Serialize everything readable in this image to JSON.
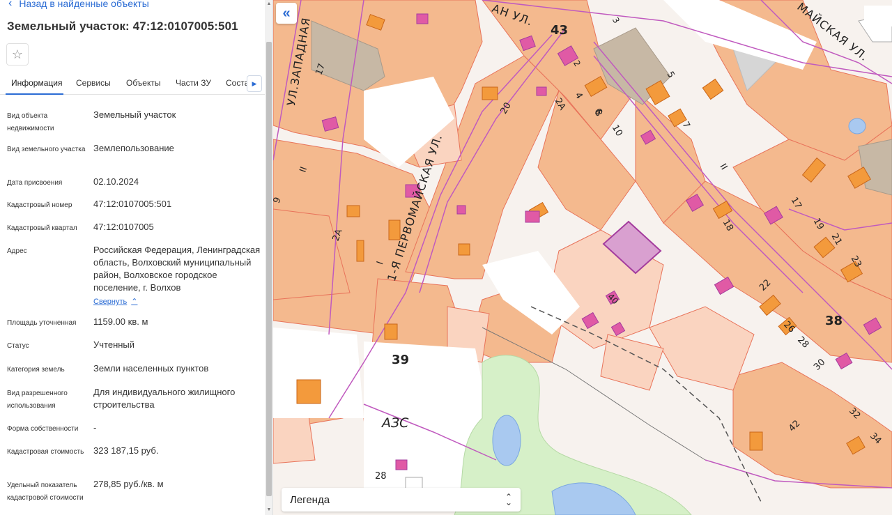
{
  "nav": {
    "back_label": "Назад в найденные объекты",
    "back_icon": "chevron-left-icon"
  },
  "title": "Земельный участок: 47:12:0107005:501",
  "favorite_icon": "star-icon",
  "tabs": [
    {
      "label": "Информация",
      "active": true
    },
    {
      "label": "Сервисы",
      "active": false
    },
    {
      "label": "Объекты",
      "active": false
    },
    {
      "label": "Части ЗУ",
      "active": false
    },
    {
      "label": "Состав",
      "active": false
    }
  ],
  "info": [
    {
      "label": "Вид объекта недвижимости",
      "value": "Земельный участок"
    },
    {
      "label": "Вид земельного участка",
      "value": "Землепользование"
    },
    {
      "label": "Дата присвоения",
      "value": "02.10.2024"
    },
    {
      "label": "Кадастровый номер",
      "value": "47:12:0107005:501"
    },
    {
      "label": "Кадастровый квартал",
      "value": "47:12:0107005"
    },
    {
      "label": "Адрес",
      "value": "Российская Федерация, Ленинградская область, Волховский муниципальный район, Волховское городское поселение, г. Волхов"
    },
    {
      "label": "Площадь уточненная",
      "value": "1159.00 кв. м"
    },
    {
      "label": "Статус",
      "value": "Учтенный"
    },
    {
      "label": "Категория земель",
      "value": "Земли населенных пунктов"
    },
    {
      "label": "Вид разрешенного использования",
      "value": "Для индивидуального жилищного строительства"
    },
    {
      "label": "Форма собственности",
      "value": "-"
    },
    {
      "label": "Кадастровая стоимость",
      "value": "323 187,15 руб."
    },
    {
      "label": "Удельный показатель кадастровой стоимости",
      "value": "278,85 руб./кв. м"
    }
  ],
  "collapse_label": "Свернуть",
  "map": {
    "collapse_icon": "double-chevron-left-icon",
    "legend_label": "Легенда",
    "streets": {
      "zapadnaya": "УЛ.ЗАПАДНАЯ",
      "pervomayskaya": "1-Я ПЕРВОМАЙСКАЯ УЛ.",
      "top_street": "АН УЛ.",
      "top_right_street": "МАЙСКАЯ УЛ."
    },
    "azs": "АЗС",
    "house_numbers": [
      "43",
      "3",
      "2",
      "2А",
      "4",
      "6",
      "8",
      "10",
      "20",
      "5",
      "7",
      "II",
      "17",
      "19",
      "21",
      "23",
      "18",
      "22",
      "26",
      "28",
      "30",
      "32",
      "34",
      "38",
      "39",
      "42",
      "40",
      "28",
      "17",
      "II",
      "9",
      "2А",
      "I",
      "I"
    ],
    "colors": {
      "parcel": "#f4b98e",
      "parcel_border": "#e8735a",
      "building": "#f39a3c",
      "building_pink": "#e05aa5",
      "road": "#ffffff",
      "road_line": "#c05abf",
      "park": "#d6f0c8",
      "water": "#a9c9f0",
      "selected": "#d9a0d0"
    }
  }
}
